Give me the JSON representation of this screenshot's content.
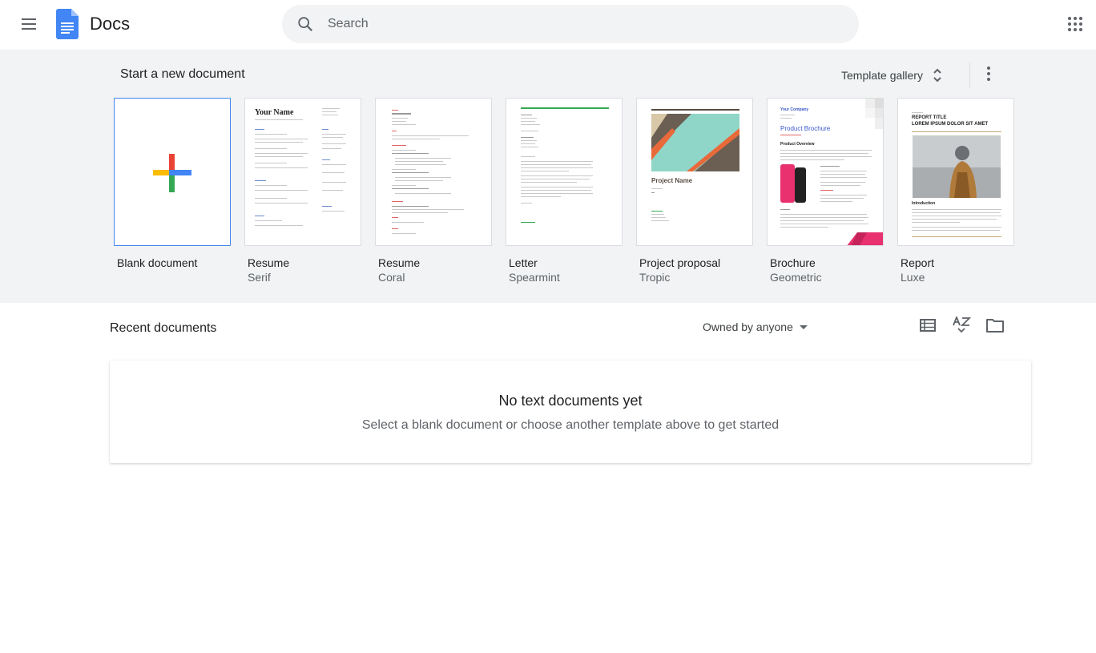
{
  "app": {
    "name": "Docs"
  },
  "search": {
    "placeholder": "Search"
  },
  "templates": {
    "heading": "Start a new document",
    "gallery_label": "Template gallery",
    "items": [
      {
        "name": "Blank document",
        "sub": ""
      },
      {
        "name": "Resume",
        "sub": "Serif",
        "preview_title": "Your Name"
      },
      {
        "name": "Resume",
        "sub": "Coral"
      },
      {
        "name": "Letter",
        "sub": "Spearmint"
      },
      {
        "name": "Project proposal",
        "sub": "Tropic",
        "preview_title": "Project Name"
      },
      {
        "name": "Brochure",
        "sub": "Geometric",
        "preview_company": "Your Company",
        "preview_title": "Product Brochure",
        "preview_section": "Product Overview"
      },
      {
        "name": "Report",
        "sub": "Luxe",
        "preview_line1": "REPORT TITLE",
        "preview_line2": "LOREM IPSUM DOLOR SIT AMET",
        "preview_section": "Introduction"
      }
    ]
  },
  "recent": {
    "heading": "Recent documents",
    "owner_filter": "Owned by anyone",
    "empty_title": "No text documents yet",
    "empty_subtitle": "Select a blank document or choose another template above to get started"
  },
  "colors": {
    "docs_blue": "#4285f4",
    "plus_red": "#ea4335",
    "plus_yellow": "#fbbc04",
    "plus_green": "#34a853",
    "band_bg": "#f1f3f4"
  },
  "icons": [
    "menu-icon",
    "docs-logo-icon",
    "search-icon",
    "apps-grid-icon",
    "unfold-icon",
    "more-vert-icon",
    "list-view-icon",
    "sort-az-icon",
    "folder-icon"
  ]
}
